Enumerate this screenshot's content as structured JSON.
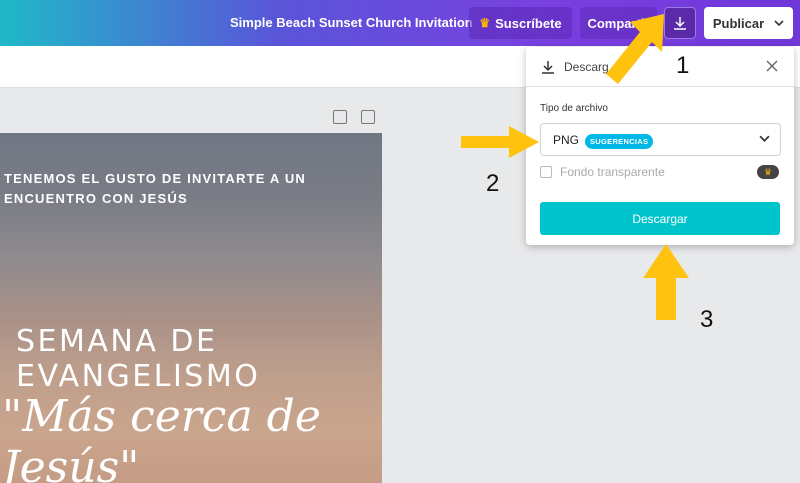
{
  "header": {
    "doc_title": "Simple Beach Sunset Church Invitation",
    "subscribe_label": "Suscríbete",
    "share_label": "Compartir",
    "publish_label": "Publicar"
  },
  "design": {
    "line1": "TENEMOS EL GUSTO DE INVITARTE A UN",
    "line2": "ENCUENTRO CON JESÚS",
    "heading": "SEMANA DE EVANGELISMO",
    "script": "\"Más cerca de Jesús\""
  },
  "download_panel": {
    "title": "Descarg",
    "file_type_label": "Tipo de archivo",
    "selected_type": "PNG",
    "badge": "SUGERENCIAS",
    "transparent_label": "Fondo transparente",
    "download_button": "Descargar"
  },
  "annotations": {
    "step1": "1",
    "step2": "2",
    "step3": "3",
    "color": "#ffc20e"
  },
  "icons": [
    "crown-icon",
    "download-icon",
    "chevron-down-icon",
    "close-icon",
    "note-icon",
    "copy-icon",
    "arrow-icon"
  ]
}
